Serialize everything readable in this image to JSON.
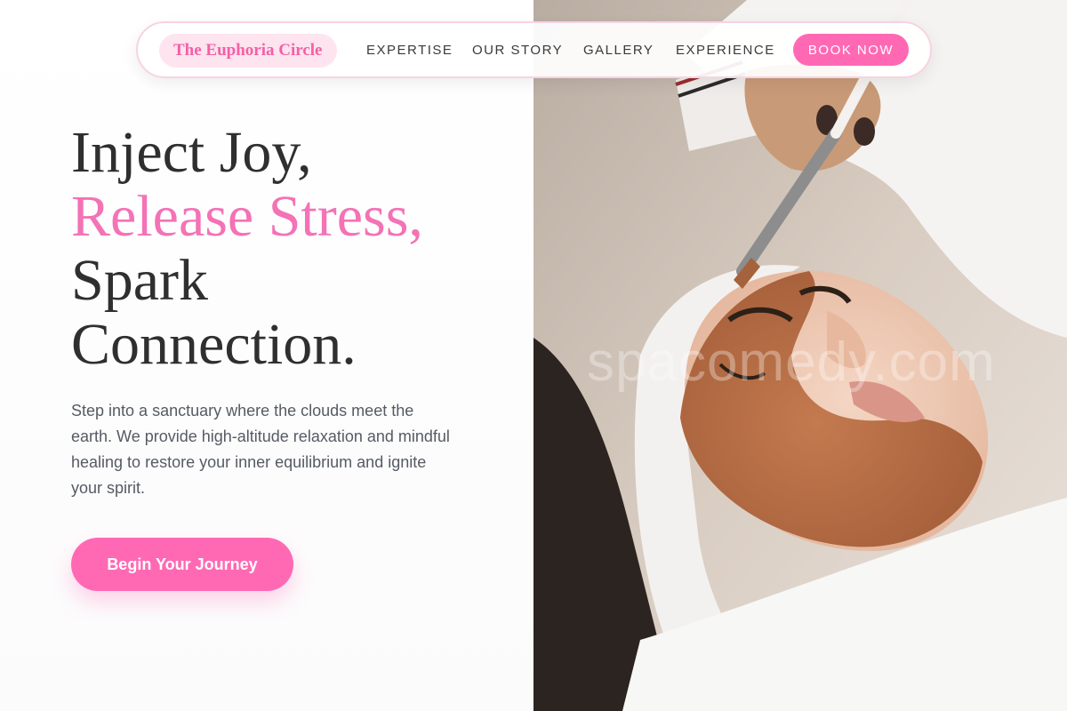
{
  "nav": {
    "brand": "The Euphoria Circle",
    "links": [
      "EXPERTISE",
      "OUR STORY",
      "GALLERY",
      "EXPERIENCE"
    ],
    "cta": "BOOK NOW"
  },
  "hero": {
    "headline": [
      "Inject Joy,",
      "Release Stress,",
      "Spark",
      "Connection."
    ],
    "lead": "Step into a sanctuary where the clouds meet the earth. We provide high-altitude relaxation and mindful healing to restore your inner equilibrium and ignite your spirit.",
    "cta": "Begin Your Journey"
  },
  "image": {
    "watermark": "spacomedy.com"
  },
  "colors": {
    "accent": "#ff69b4",
    "brand_text": "#f45fa6",
    "heading": "#2f2f2f",
    "body_text": "#555b63"
  }
}
